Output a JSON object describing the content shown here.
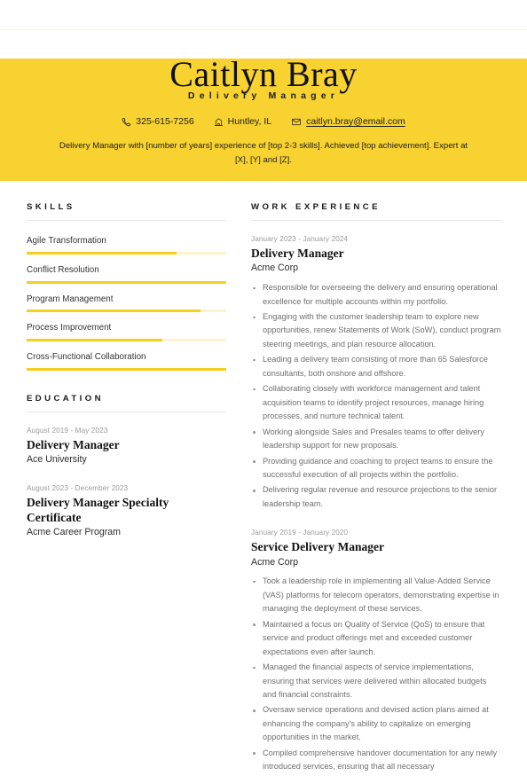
{
  "theme": {
    "accent": "#F7D230",
    "accent_bar": "#F5CE1E",
    "accent_track": "#FDF3CF",
    "text": "#2B2B2B",
    "muted": "#6F6F6F",
    "date": "#9A9A9A"
  },
  "header": {
    "name": "Caitlyn Bray",
    "title": "Delivery Manager",
    "contacts": [
      {
        "icon": "phone-icon",
        "text": "325-615-7256",
        "link": false
      },
      {
        "icon": "location-building-icon",
        "text": "Huntley, IL",
        "link": false
      },
      {
        "icon": "envelope-icon",
        "text": "caitlyn.bray@email.com",
        "link": true
      }
    ],
    "summary": "Delivery Manager with [number of years] experience of [top 2-3 skills]. Achieved [top achievement]. Expert at [X], [Y] and [Z]."
  },
  "skills": {
    "heading": "SKILLS",
    "items": [
      {
        "label": "Agile Transformation",
        "level": 75
      },
      {
        "label": "Conflict Resolution",
        "level": 100
      },
      {
        "label": "Program Management",
        "level": 87
      },
      {
        "label": "Process Improvement",
        "level": 68
      },
      {
        "label": "Cross-Functional Collaboration",
        "level": 100
      }
    ]
  },
  "education": {
    "heading": "EDUCATION",
    "items": [
      {
        "date": "August 2019 - May 2023",
        "title": "Delivery Manager",
        "org": "Ace University"
      },
      {
        "date": "August 2023 - December 2023",
        "title": "Delivery Manager Specialty Certificate",
        "org": "Acme Career Program"
      }
    ]
  },
  "work": {
    "heading": "WORK EXPERIENCE",
    "items": [
      {
        "date": "January 2023 - January 2024",
        "title": "Delivery Manager",
        "org": "Acme Corp",
        "bullets": [
          "Responsible for overseeing the delivery and ensuring operational excellence for multiple accounts within my portfolio.",
          "Engaging with the customer leadership team to explore new opportunities, renew Statements of Work (SoW), conduct program steering meetings, and plan resource allocation.",
          "Leading a delivery team consisting of more than 65 Salesforce consultants, both onshore and offshore.",
          "Collaborating closely with workforce management and talent acquisition teams to identify project resources, manage hiring processes, and nurture technical talent.",
          "Working alongside Sales and Presales teams to offer delivery leadership support for new proposals.",
          "Providing guidance and coaching to project teams to ensure the successful execution of all projects within the portfolio.",
          "Delivering regular revenue and resource projections to the senior leadership team."
        ]
      },
      {
        "date": "January 2019 - January 2020",
        "title": "Service Delivery Manager",
        "org": "Acme Corp",
        "bullets": [
          "Took a leadership role in implementing all Value-Added Service (VAS) platforms for telecom operators, demonstrating expertise in managing the deployment of these services.",
          "Maintained a focus on Quality of Service (QoS) to ensure that service and product offerings met and exceeded customer expectations even after launch.",
          "Managed the financial aspects of service implementations, ensuring that services were delivered within allocated budgets and financial constraints.",
          "Oversaw service operations and devised action plans aimed at enhancing the company's ability to capitalize on emerging opportunities in the market.",
          "Compiled comprehensive handover documentation for any newly introduced services, ensuring that all necessary"
        ]
      }
    ]
  }
}
